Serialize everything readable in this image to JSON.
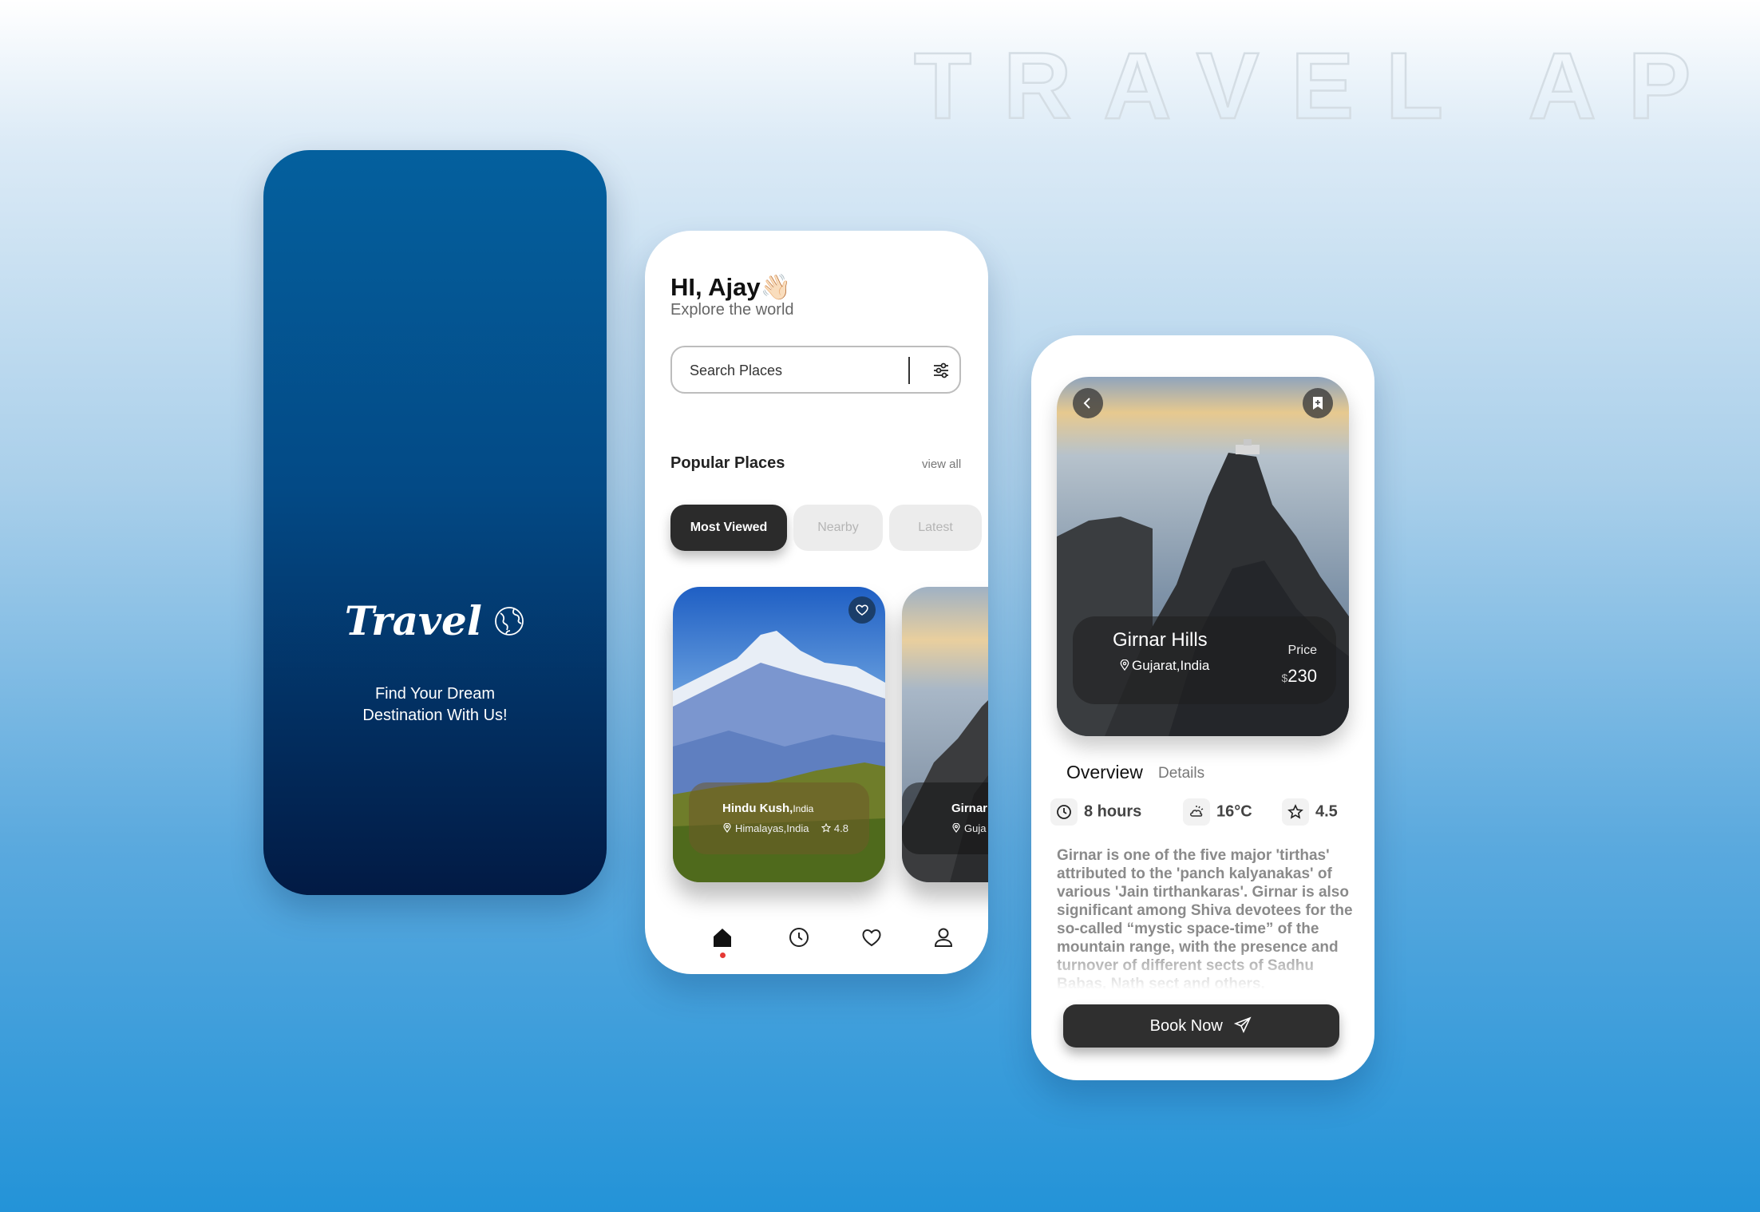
{
  "headline": "TRAVEL APP",
  "splash": {
    "logo_text": "Travel",
    "logo_icon": "globe-icon",
    "tagline_line1": "Find Your Dream",
    "tagline_line2": "Destination With Us!"
  },
  "home": {
    "greeting": "HI, Ajay👋🏻",
    "subtitle": "Explore the world",
    "search_placeholder": "Search Places",
    "section_title": "Popular Places",
    "view_all": "view all",
    "chips": [
      "Most Viewed",
      "Nearby",
      "Latest"
    ],
    "cards": [
      {
        "name": "Hindu Kush,",
        "country": "India",
        "location": "Himalayas,India",
        "rating": "4.8"
      },
      {
        "name": "Girnar",
        "location": "Guja"
      }
    ],
    "nav": [
      "home-icon",
      "clock-icon",
      "heart-icon",
      "user-icon"
    ]
  },
  "detail": {
    "place_name": "Girnar Hills",
    "location": "Gujarat,India",
    "price_label": "Price",
    "currency": "$",
    "price_value": "230",
    "tabs": [
      "Overview",
      "Details"
    ],
    "duration": "8 hours",
    "temperature": "16°C",
    "rating": "4.5",
    "description": "Girnar is one of the five major 'tirthas' attributed to the 'panch kalyanakas' of various 'Jain tirthankaras'. Girnar is also significant among Shiva devotees for the so-called “mystic space-time” of the mountain range, with the presence and turnover of different sects of Sadhu Babas, Nath sect and others.",
    "book_label": "Book Now"
  },
  "colors": {
    "splash_top": "#04609e",
    "splash_bottom": "#021a44",
    "dark_button": "#2b2b2b",
    "nav_dot": "#e53935"
  }
}
